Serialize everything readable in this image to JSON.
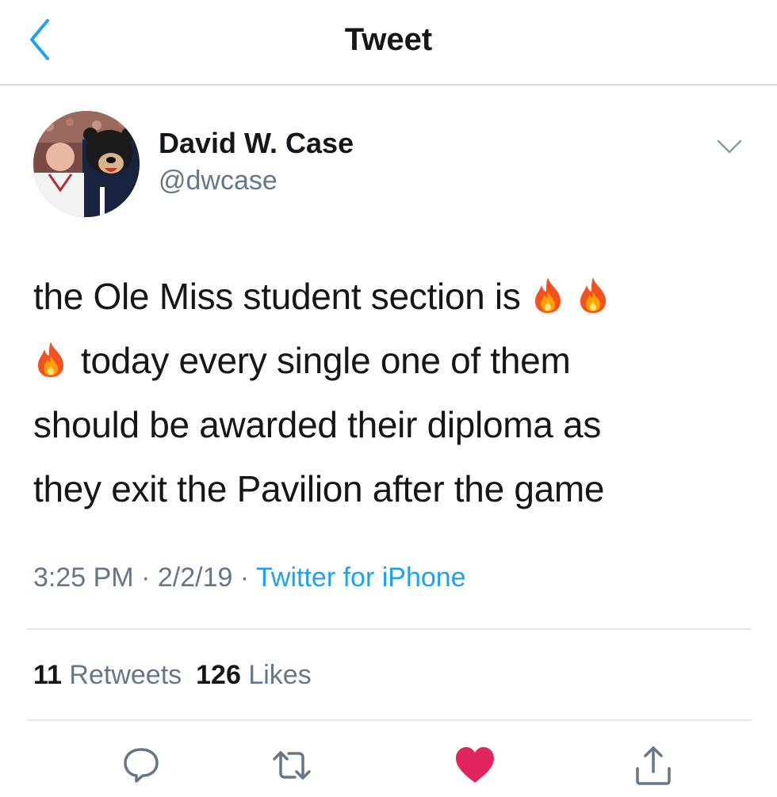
{
  "header": {
    "title": "Tweet",
    "back_icon": "chevron-left-icon"
  },
  "tweet": {
    "author": {
      "name": "David W. Case",
      "handle": "@dwcase",
      "avatar": "profile-photo"
    },
    "text_lines": [
      "the Ole Miss student section is",
      "today every single one of them",
      "should be awarded their diploma as",
      "they exit the Pavilion after the game"
    ],
    "emoji": "fire-emoji",
    "time": "3:25 PM",
    "separator": "·",
    "date": "2/2/19",
    "source": "Twitter for iPhone",
    "retweets_count": "11",
    "retweets_label": "Retweets",
    "likes_count": "126",
    "likes_label": "Likes"
  },
  "actions": [
    "reply-icon",
    "retweet-icon",
    "like-icon",
    "share-icon"
  ],
  "colors": {
    "accent": "#1da1f2",
    "secondary_text": "#657786",
    "like": "#e0245e",
    "divider": "#e1e8ed"
  }
}
